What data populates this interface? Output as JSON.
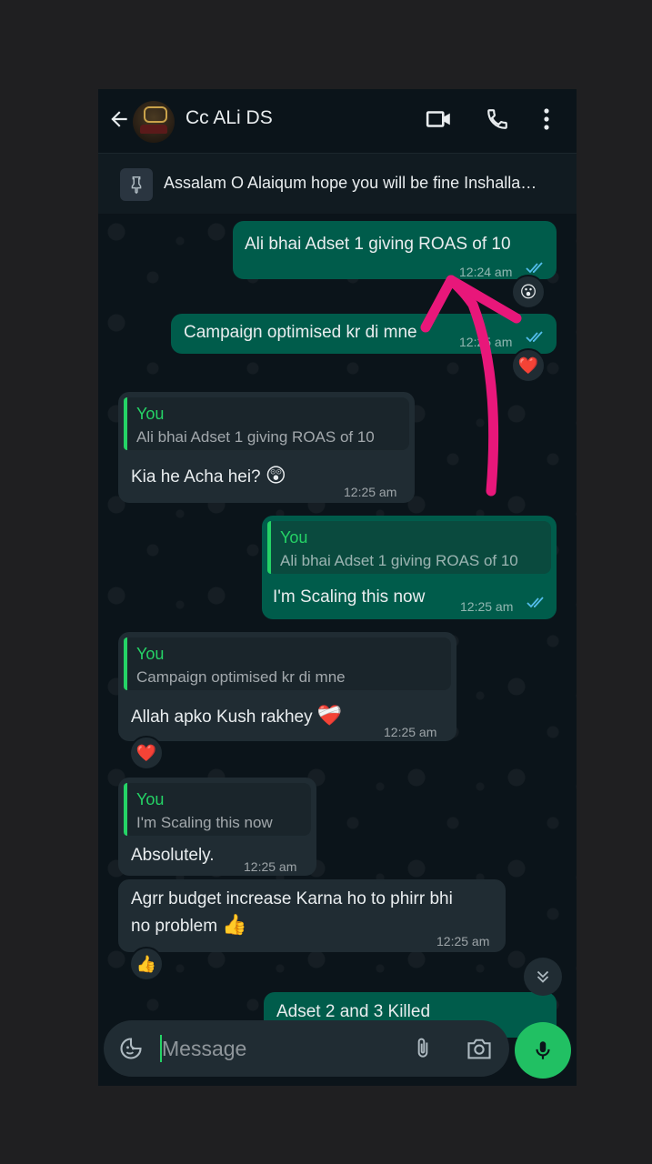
{
  "header": {
    "contact_name": "Cc ALi DS"
  },
  "pinned": {
    "text": "Assalam O Alaiqum hope you will be fine Inshalla…"
  },
  "messages": {
    "m1": {
      "text": "Ali bhai Adset 1 giving ROAS of 10",
      "time": "12:24 am",
      "reaction": "😮"
    },
    "m2": {
      "text": "Campaign optimised kr di mne",
      "time": "12:25 am",
      "reaction": "❤️"
    },
    "m3": {
      "quote_name": "You",
      "quote_text": "Ali bhai Adset 1 giving ROAS of 10",
      "text": "Kia he Acha hei?",
      "emoji": "😲",
      "time": "12:25 am"
    },
    "m4": {
      "quote_name": "You",
      "quote_text": "Ali bhai Adset 1 giving ROAS of 10",
      "text": "I'm Scaling this now",
      "time": "12:25 am"
    },
    "m5": {
      "quote_name": "You",
      "quote_text": "Campaign optimised kr di mne",
      "text": "Allah apko Kush rakhey",
      "emoji": "❤️‍🩹",
      "time": "12:25 am",
      "reaction": "❤️"
    },
    "m6": {
      "quote_name": "You",
      "quote_text": "I'm Scaling this now",
      "text": "Absolutely.",
      "time": "12:25 am"
    },
    "m7": {
      "text_line1": "Agrr budget increase Karna ho to phirr bhi",
      "text_line2": "no problem",
      "emoji": "👍",
      "time": "12:25 am",
      "reaction": "👍"
    },
    "m8": {
      "text": "Adset 2 and 3 Killed"
    }
  },
  "input": {
    "placeholder": "Message"
  },
  "colors": {
    "outgoing_bubble": "#005c4b",
    "incoming_bubble": "#202c33",
    "accent_green": "#25d366",
    "annotation_arrow": "#e8177a"
  }
}
